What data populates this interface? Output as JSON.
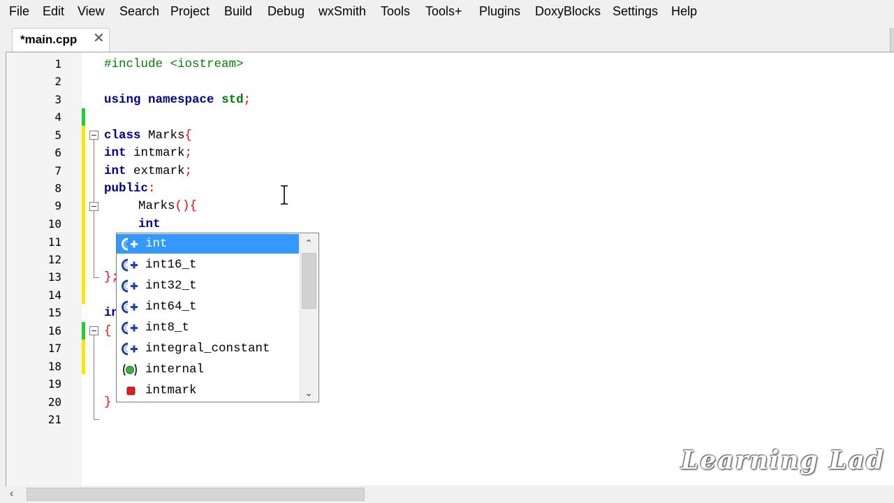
{
  "menubar": {
    "items": [
      "File",
      "Edit",
      "View",
      "Search",
      "Project",
      "Build",
      "Debug",
      "wxSmith",
      "Tools",
      "Tools+",
      "Plugins",
      "DoxyBlocks",
      "Settings",
      "Help"
    ]
  },
  "tab": {
    "label": "*main.cpp",
    "close": "✕"
  },
  "editor": {
    "line_numbers": [
      "1",
      "2",
      "3",
      "4",
      "5",
      "6",
      "7",
      "8",
      "9",
      "10",
      "11",
      "12",
      "13",
      "14",
      "15",
      "16",
      "17",
      "18",
      "19",
      "20",
      "21"
    ],
    "code": {
      "l1_include": "#include",
      "l1_header": " <iostream>",
      "l3_using": "using",
      "l3_namespace": "namespace",
      "l3_std": "std",
      "l3_semi": ";",
      "l5_class": "class",
      "l5_name": " Marks",
      "l5_brace": "{",
      "l6_type": "int",
      "l6_name": " intmark",
      "l6_semi": ";",
      "l7_type": "int",
      "l7_name": " extmark",
      "l7_semi": ";",
      "l8_public": "public",
      "l8_colon": ":",
      "l9_name": "Marks",
      "l9_parens": "(){",
      "l10_type": "int",
      "l13_close": "};",
      "l15_partial": "in",
      "l16_brace": "{",
      "l20_brace": "}"
    }
  },
  "autocomplete": {
    "items": [
      {
        "label": "int",
        "icon": "class-icon",
        "selected": true
      },
      {
        "label": "int16_t",
        "icon": "class-icon",
        "selected": false
      },
      {
        "label": "int32_t",
        "icon": "class-icon",
        "selected": false
      },
      {
        "label": "int64_t",
        "icon": "class-icon",
        "selected": false
      },
      {
        "label": "int8_t",
        "icon": "class-icon",
        "selected": false
      },
      {
        "label": "integral_constant",
        "icon": "class-icon",
        "selected": false
      },
      {
        "label": "internal",
        "icon": "namespace-icon",
        "selected": false
      },
      {
        "label": "intmark",
        "icon": "private-variable-icon",
        "selected": false
      }
    ]
  },
  "watermark": {
    "text": "Learning Lad"
  },
  "colors": {
    "keyword": "#00008b",
    "preprocessor": "#008000",
    "punctuation": "#ff0000",
    "selection": "#3399ff",
    "changed_line": "#ffe600",
    "saved_line": "#22cc33"
  }
}
